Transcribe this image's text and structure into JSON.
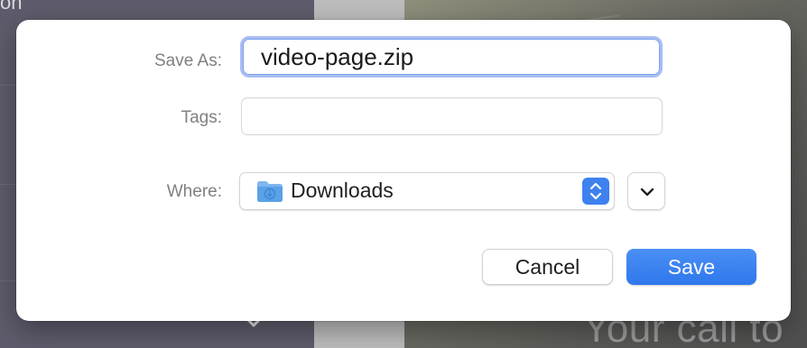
{
  "background": {
    "left_text": "on",
    "bottom_text": "Your call to"
  },
  "dialog": {
    "save_as_label": "Save As:",
    "save_as_value": "video-page.zip",
    "tags_label": "Tags:",
    "tags_value": "",
    "where_label": "Where:",
    "where_value": "Downloads",
    "where_icon": "downloads-folder-icon",
    "stepper_icon": "up-down-chevron-icon",
    "expand_icon": "chevron-down-icon",
    "cancel_label": "Cancel",
    "save_label": "Save",
    "accent_color": "#3e82f0"
  }
}
